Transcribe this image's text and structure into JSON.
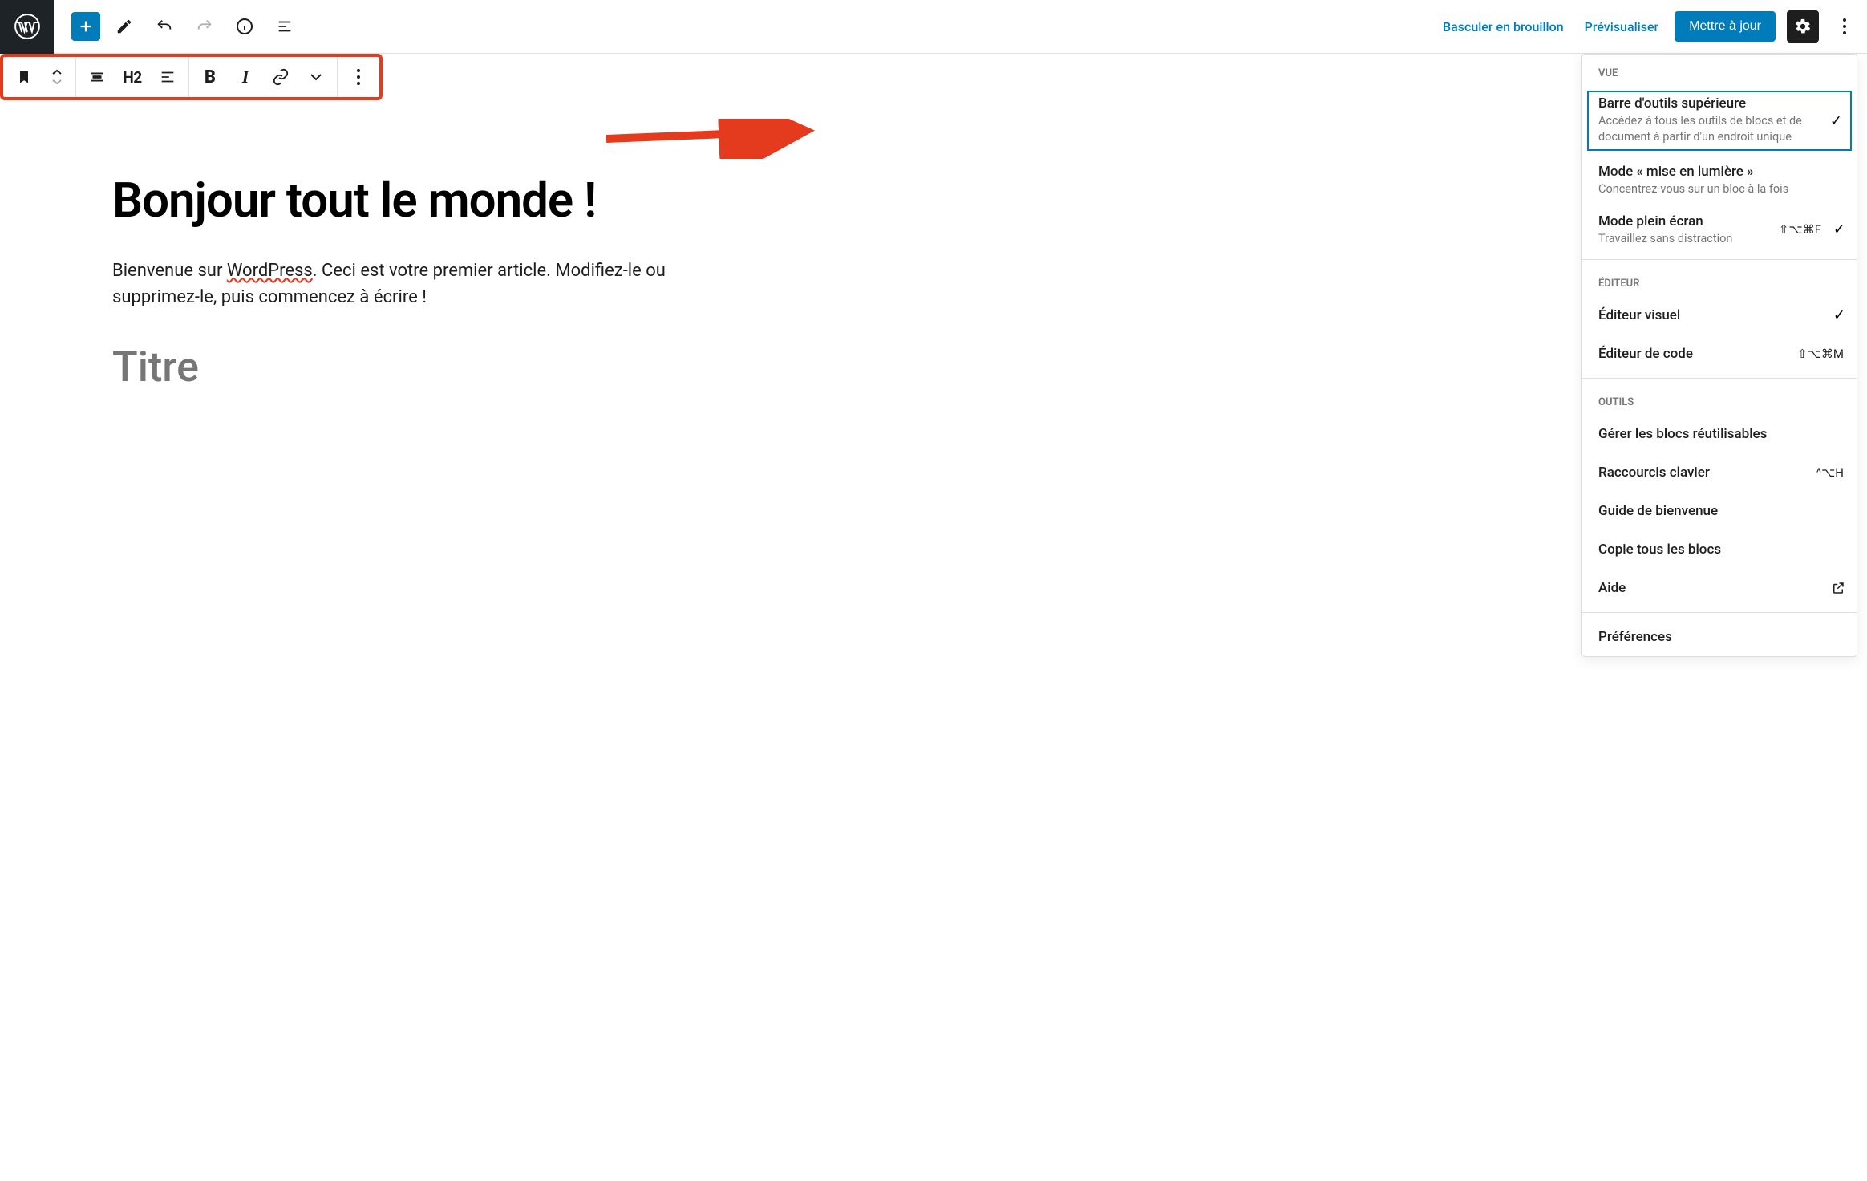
{
  "header": {
    "draft_label": "Basculer en brouillon",
    "preview_label": "Prévisualiser",
    "update_label": "Mettre à jour"
  },
  "block_toolbar": {
    "heading_level": "H2"
  },
  "post": {
    "title": "Bonjour tout le monde !",
    "paragraph_pre": "Bienvenue sur ",
    "paragraph_spell": "WordPress",
    "paragraph_post": ". Ceci est votre premier article. Modifiez-le ou supprimez-le, puis commencez à écrire !",
    "heading_placeholder": "Titre"
  },
  "menu": {
    "sections": {
      "view": "VUE",
      "editor": "ÉDITEUR",
      "tools": "OUTILS"
    },
    "top_toolbar": {
      "title": "Barre d'outils supérieure",
      "desc": "Accédez à tous les outils de blocs et de document à partir d'un endroit unique"
    },
    "spotlight": {
      "title": "Mode « mise en lumière »",
      "desc": "Concentrez-vous sur un bloc à la fois"
    },
    "fullscreen": {
      "title": "Mode plein écran",
      "desc": "Travaillez sans distraction",
      "shortcut": "⇧⌥⌘F"
    },
    "visual_editor": "Éditeur visuel",
    "code_editor": "Éditeur de code",
    "code_editor_shortcut": "⇧⌥⌘M",
    "reusable": "Gérer les blocs réutilisables",
    "shortcuts": "Raccourcis clavier",
    "shortcuts_shortcut": "^⌥H",
    "welcome": "Guide de bienvenue",
    "copy_all": "Copie tous les blocs",
    "help": "Aide",
    "prefs": "Préférences"
  }
}
